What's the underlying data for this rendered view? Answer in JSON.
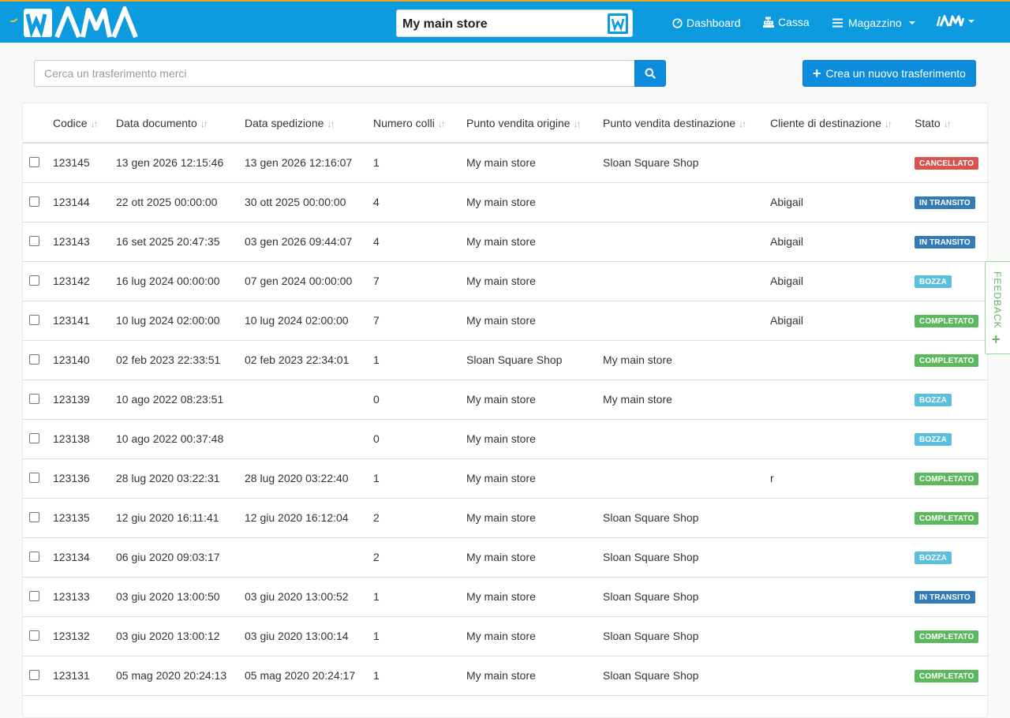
{
  "header": {
    "logo_text": "WAMA",
    "store_name": "My main store",
    "nav": {
      "dashboard": "Dashboard",
      "cassa": "Cassa",
      "magazzino": "Magazzino"
    },
    "user_logo_text": "AM"
  },
  "search": {
    "placeholder": "Cerca un trasferimento merci"
  },
  "create_button_label": "Crea un nuovo trasferimento",
  "table": {
    "columns": [
      "Codice",
      "Data documento",
      "Data spedizione",
      "Numero colli",
      "Punto vendita origine",
      "Punto vendita destinazione",
      "Cliente di destinazione",
      "Stato"
    ],
    "rows": [
      {
        "code": "123145",
        "doc_date": "13 gen 2026 12:15:46",
        "ship_date": "13 gen 2026 12:16:07",
        "packages": "1",
        "origin": "My main store",
        "destination": "Sloan Square Shop",
        "customer": "",
        "status": "CANCELLATO",
        "status_type": "cancel"
      },
      {
        "code": "123144",
        "doc_date": "22 ott 2025 00:00:00",
        "ship_date": "30 ott 2025 00:00:00",
        "packages": "4",
        "origin": "My main store",
        "destination": "",
        "customer": "Abigail",
        "status": "IN TRANSITO",
        "status_type": "transit"
      },
      {
        "code": "123143",
        "doc_date": "16 set 2025 20:47:35",
        "ship_date": "03 gen 2026 09:44:07",
        "packages": "4",
        "origin": "My main store",
        "destination": "",
        "customer": "Abigail",
        "status": "IN TRANSITO",
        "status_type": "transit"
      },
      {
        "code": "123142",
        "doc_date": "16 lug 2024 00:00:00",
        "ship_date": "07 gen 2024 00:00:00",
        "packages": "7",
        "origin": "My main store",
        "destination": "",
        "customer": "Abigail",
        "status": "BOZZA",
        "status_type": "draft"
      },
      {
        "code": "123141",
        "doc_date": "10 lug 2024 02:00:00",
        "ship_date": "10 lug 2024 02:00:00",
        "packages": "7",
        "origin": "My main store",
        "destination": "",
        "customer": "Abigail",
        "status": "COMPLETATO",
        "status_type": "done"
      },
      {
        "code": "123140",
        "doc_date": "02 feb 2023 22:33:51",
        "ship_date": "02 feb 2023 22:34:01",
        "packages": "1",
        "origin": "Sloan Square Shop",
        "destination": "My main store",
        "customer": "",
        "status": "COMPLETATO",
        "status_type": "done"
      },
      {
        "code": "123139",
        "doc_date": "10 ago 2022 08:23:51",
        "ship_date": "",
        "packages": "0",
        "origin": "My main store",
        "destination": "My main store",
        "customer": "",
        "status": "BOZZA",
        "status_type": "draft"
      },
      {
        "code": "123138",
        "doc_date": "10 ago 2022 00:37:48",
        "ship_date": "",
        "packages": "0",
        "origin": "My main store",
        "destination": "",
        "customer": "",
        "status": "BOZZA",
        "status_type": "draft"
      },
      {
        "code": "123136",
        "doc_date": "28 lug 2020 03:22:31",
        "ship_date": "28 lug 2020 03:22:40",
        "packages": "1",
        "origin": "My main store",
        "destination": "",
        "customer": "r",
        "status": "COMPLETATO",
        "status_type": "done"
      },
      {
        "code": "123135",
        "doc_date": "12 giu 2020 16:11:41",
        "ship_date": "12 giu 2020 16:12:04",
        "packages": "2",
        "origin": "My main store",
        "destination": "Sloan Square Shop",
        "customer": "",
        "status": "COMPLETATO",
        "status_type": "done"
      },
      {
        "code": "123134",
        "doc_date": "06 giu 2020 09:03:17",
        "ship_date": "",
        "packages": "2",
        "origin": "My main store",
        "destination": "Sloan Square Shop",
        "customer": "",
        "status": "BOZZA",
        "status_type": "draft"
      },
      {
        "code": "123133",
        "doc_date": "03 giu 2020 13:00:50",
        "ship_date": "03 giu 2020 13:00:52",
        "packages": "1",
        "origin": "My main store",
        "destination": "Sloan Square Shop",
        "customer": "",
        "status": "IN TRANSITO",
        "status_type": "transit"
      },
      {
        "code": "123132",
        "doc_date": "03 giu 2020 13:00:12",
        "ship_date": "03 giu 2020 13:00:14",
        "packages": "1",
        "origin": "My main store",
        "destination": "Sloan Square Shop",
        "customer": "",
        "status": "COMPLETATO",
        "status_type": "done"
      },
      {
        "code": "123131",
        "doc_date": "05 mag 2020 20:24:13",
        "ship_date": "05 mag 2020 20:24:17",
        "packages": "1",
        "origin": "My main store",
        "destination": "Sloan Square Shop",
        "customer": "",
        "status": "COMPLETATO",
        "status_type": "done"
      }
    ]
  },
  "feedback_label": "FEEDBACK",
  "colors": {
    "navbar": "#0d9be0",
    "navbar_top_border": "#f1a31c",
    "primary_button": "#0d8ddb",
    "status_cancel": "#d9534f",
    "status_transit": "#337ab7",
    "status_draft": "#5bc0de",
    "status_done": "#5cb85c"
  }
}
